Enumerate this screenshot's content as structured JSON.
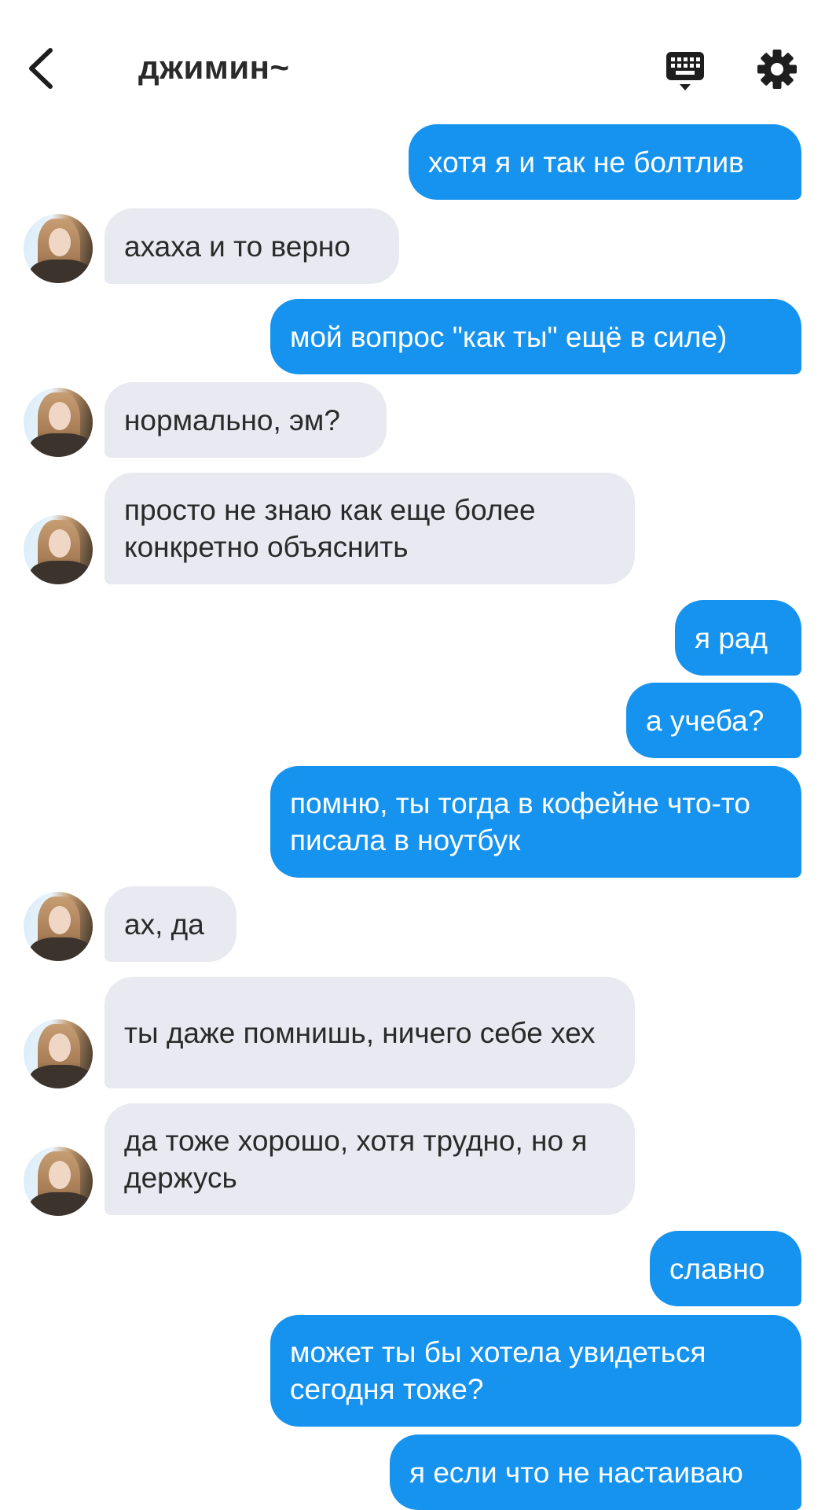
{
  "header": {
    "back_icon": "chevron-left-icon",
    "title": "джимин~",
    "keyboard_icon": "keyboard-icon",
    "settings_icon": "gear-icon"
  },
  "colors": {
    "sent_bubble": "#1693ee",
    "received_bubble": "#e9eaf1",
    "text_dark": "#2a2a2a"
  },
  "messages": [
    {
      "from": "me",
      "text": "хотя я и так не болтлив"
    },
    {
      "from": "them",
      "text": "ахаха и то верно"
    },
    {
      "from": "me",
      "text": "мой вопрос \"как ты\" ещё в силе)"
    },
    {
      "from": "them",
      "text": "нормально, эм?"
    },
    {
      "from": "them",
      "text": "просто не знаю как еще более конкретно объяснить"
    },
    {
      "from": "me",
      "text": "я рад"
    },
    {
      "from": "me",
      "text": "а учеба?"
    },
    {
      "from": "me",
      "text": "помню, ты тогда в кофейне что-то писала в ноутбук"
    },
    {
      "from": "them",
      "text": "ах, да"
    },
    {
      "from": "them",
      "text": "ты даже помнишь, ничего себе хех"
    },
    {
      "from": "them",
      "text": "да тоже хорошо, хотя трудно, но я держусь"
    },
    {
      "from": "me",
      "text": "славно"
    },
    {
      "from": "me",
      "text": "может ты бы хотела увидеться сегодня тоже?"
    },
    {
      "from": "me",
      "text": "я если что не настаиваю"
    }
  ]
}
